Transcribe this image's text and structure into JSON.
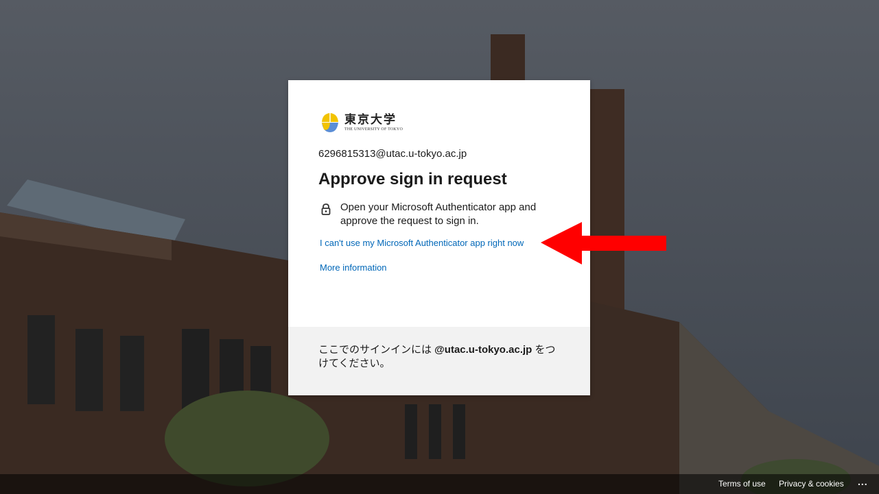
{
  "logo": {
    "name_jp": "東京大学",
    "name_en": "THE UNIVERSITY OF TOKYO"
  },
  "account_email": "6296815313@utac.u-tokyo.ac.jp",
  "title": "Approve sign in request",
  "instruction": "Open your Microsoft Authenticator app and approve the request to sign in.",
  "links": {
    "cant_use_app": "I can't use my Microsoft Authenticator app right now",
    "more_info": "More information"
  },
  "footer_note": {
    "before": "ここでのサインインには ",
    "domain": "@utac.u-tokyo.ac.jp",
    "after": " をつけてください。"
  },
  "bottom_links": {
    "terms": "Terms of use",
    "privacy": "Privacy & cookies",
    "more": "..."
  },
  "colors": {
    "link": "#0067b8",
    "arrow": "#ff0000",
    "footer_bg": "#f2f2f2"
  },
  "icons": {
    "lock": "lock-icon",
    "arrow": "red-arrow-left-icon",
    "logo": "ginkgo-logo-icon"
  }
}
